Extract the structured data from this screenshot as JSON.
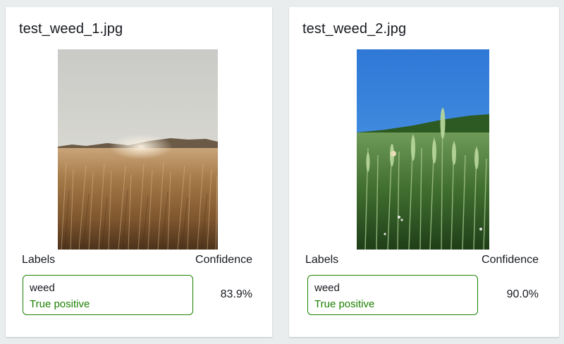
{
  "colors": {
    "page_background": "#eaeded",
    "card_background": "#ffffff",
    "true_positive": "#1d8102"
  },
  "results": [
    {
      "file_name": "test_weed_1.jpg",
      "labels_header": "Labels",
      "confidence_header": "Confidence",
      "label": "weed",
      "status": "True positive",
      "confidence": "83.9%"
    },
    {
      "file_name": "test_weed_2.jpg",
      "labels_header": "Labels",
      "confidence_header": "Confidence",
      "label": "weed",
      "status": "True positive",
      "confidence": "90.0%"
    }
  ]
}
